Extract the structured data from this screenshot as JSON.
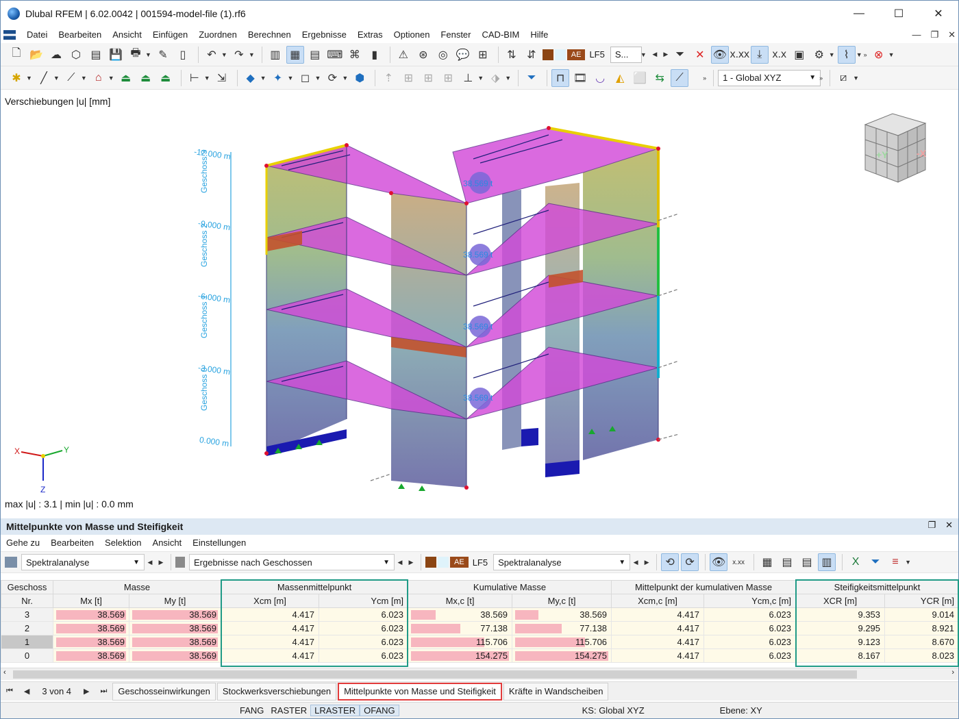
{
  "app": {
    "title": "Dlubal RFEM | 6.02.0042 | 001594-model-file (1).rf6",
    "minimize": "—",
    "maximize": "☐",
    "close": "✕"
  },
  "menu": [
    "Datei",
    "Bearbeiten",
    "Ansicht",
    "Einfügen",
    "Zuordnen",
    "Berechnen",
    "Ergebnisse",
    "Extras",
    "Optionen",
    "Fenster",
    "CAD-BIM",
    "Hilfe"
  ],
  "toolbar": {
    "loadcase_badge": "AE",
    "loadcase_id": "LF5",
    "loadcase_short": "S...",
    "coord_system": "1 - Global XYZ",
    "overflow": "»"
  },
  "viewport": {
    "result_label": "Verschiebungen |u| [mm]",
    "minmax": "max |u| : 3.1 | min |u| : 0.0 mm",
    "levels": [
      "-12.000 m",
      "-9.000 m",
      "-6.000 m",
      "-3.000 m",
      "0.000 m"
    ],
    "storeys": [
      "Geschoss 3",
      "Geschoss 2",
      "Geschoss 1",
      "Geschoss 0"
    ],
    "mass_label": "38.569 t",
    "navcube_y": "+Y",
    "navcube_x": "-X",
    "axis_x": "X",
    "axis_y": "Y",
    "axis_z": "Z"
  },
  "panel": {
    "title": "Mittelpunkte von Masse und Steifigkeit",
    "menu": [
      "Gehe zu",
      "Bearbeiten",
      "Selektion",
      "Ansicht",
      "Einstellungen"
    ],
    "analysis_combo": "Spektralanalyse",
    "results_combo": "Ergebnisse nach Geschossen",
    "lc_badge": "AE",
    "lc_id": "LF5",
    "lc_name": "Spektralanalyse"
  },
  "table": {
    "group_headers": [
      "Geschoss",
      "Masse",
      "Massenmittelpunkt",
      "Kumulative Masse",
      "Mittelpunkt der kumulativen Masse",
      "Steifigkeitsmittelpunkt"
    ],
    "nr_header": "Nr.",
    "columns": [
      "Mx [t]",
      "My [t]",
      "Xcm [m]",
      "Ycm [m]",
      "Mx,c [t]",
      "My,c [t]",
      "Xcm,c [m]",
      "Ycm,c [m]",
      "XCR [m]",
      "YCR [m]"
    ],
    "rows": [
      {
        "nr": "3",
        "mx": "38.569",
        "my": "38.569",
        "xcm": "4.417",
        "ycm": "6.023",
        "mxc": "38.569",
        "myc": "38.569",
        "xcmc": "4.417",
        "ycmc": "6.023",
        "xcr": "9.353",
        "ycr": "9.014",
        "frac_c": 0.25
      },
      {
        "nr": "2",
        "mx": "38.569",
        "my": "38.569",
        "xcm": "4.417",
        "ycm": "6.023",
        "mxc": "77.138",
        "myc": "77.138",
        "xcmc": "4.417",
        "ycmc": "6.023",
        "xcr": "9.295",
        "ycr": "8.921",
        "frac_c": 0.5
      },
      {
        "nr": "1",
        "mx": "38.569",
        "my": "38.569",
        "xcm": "4.417",
        "ycm": "6.023",
        "mxc": "115.706",
        "myc": "115.706",
        "xcmc": "4.417",
        "ycmc": "6.023",
        "xcr": "9.123",
        "ycr": "8.670",
        "frac_c": 0.75
      },
      {
        "nr": "0",
        "mx": "38.569",
        "my": "38.569",
        "xcm": "4.417",
        "ycm": "6.023",
        "mxc": "154.275",
        "myc": "154.275",
        "xcmc": "4.417",
        "ycmc": "6.023",
        "xcr": "8.167",
        "ycr": "8.023",
        "frac_c": 1.0
      }
    ]
  },
  "tabs": {
    "page_count": "3 von 4",
    "items": [
      "Geschosseinwirkungen",
      "Stockwerksverschiebungen",
      "Mittelpunkte von Masse und Steifigkeit",
      "Kräfte in Wandscheiben"
    ]
  },
  "statusbar": {
    "items": [
      "FANG",
      "RASTER",
      "LRASTER",
      "OFANG"
    ],
    "ks": "KS: Global XYZ",
    "plane": "Ebene: XY"
  }
}
